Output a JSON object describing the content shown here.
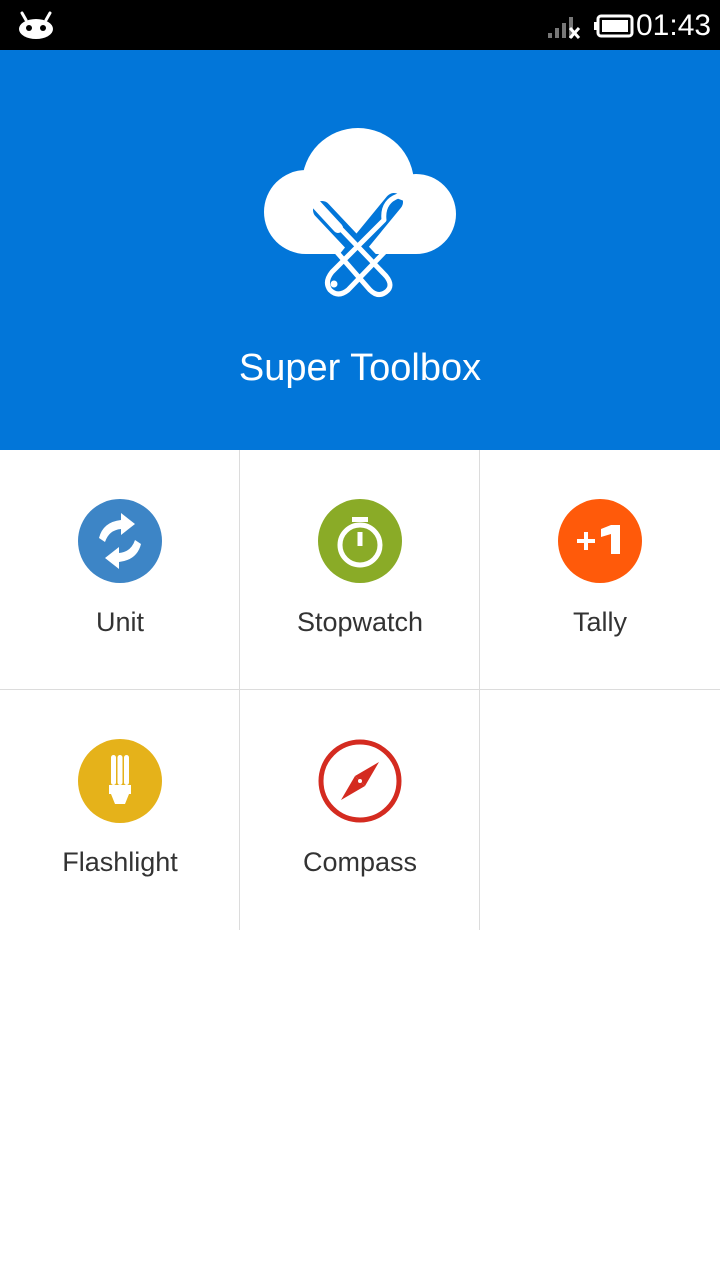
{
  "status_bar": {
    "time": "01:43",
    "icons": [
      "android-notification-icon",
      "signal-no-service-icon",
      "battery-full-icon"
    ]
  },
  "header": {
    "title": "Super Toolbox",
    "logo_icon": "cloud-tools-icon",
    "background_color": "#0276d9"
  },
  "tools": [
    {
      "label": "Unit",
      "icon": "unit-convert-icon",
      "color": "#3d85c6"
    },
    {
      "label": "Stopwatch",
      "icon": "stopwatch-icon",
      "color": "#8aab27"
    },
    {
      "label": "Tally",
      "icon": "tally-plus-one-icon",
      "color": "#ff5a0a"
    },
    {
      "label": "Flashlight",
      "icon": "flashlight-bulb-icon",
      "color": "#e5b21a"
    },
    {
      "label": "Compass",
      "icon": "compass-icon",
      "color": "#d42b20"
    }
  ]
}
